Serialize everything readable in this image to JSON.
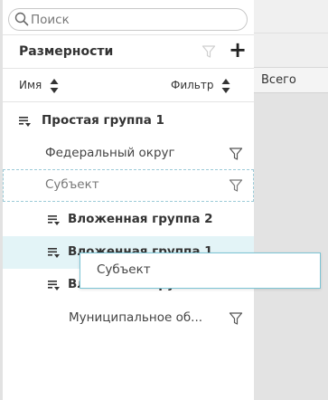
{
  "search": {
    "placeholder": "Поиск",
    "value": ""
  },
  "dimensions": {
    "title": "Размерности",
    "add_label": "+"
  },
  "columns": {
    "name": "Имя",
    "filter": "Фильтр"
  },
  "tree": {
    "group1": "Простая группа 1",
    "item_federal": "Федеральный округ",
    "item_subject": "Субъект",
    "nested2": "Вложенная группа 2",
    "nested1": "Вложенная группа 1",
    "nested3": "Вложенная группа 3",
    "item_municipal": "Муниципальное об..."
  },
  "right_pane": {
    "total": "Всего"
  },
  "drag_ghost": {
    "label": "Субъект"
  },
  "colors": {
    "accent": "#7cc4d4",
    "drop_highlight": "#e3f4f7",
    "dashed_border": "#9ccbd8"
  }
}
